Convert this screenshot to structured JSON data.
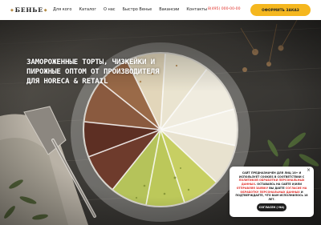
{
  "header": {
    "logo": "БЕНЬЕ",
    "nav": [
      "Для кого",
      "Каталог",
      "О нас",
      "Быстро Венье",
      "Вакансии",
      "Контакты"
    ],
    "phone": "8(495) 000-00-00",
    "order_button": "ОФОРМИТЬ ЗАКАЗ"
  },
  "hero": {
    "headline_lines": [
      "ЗАМОРОЖЕННЫЕ ТОРТЫ, ЧИЗКЕЙКИ И",
      "ПИРОЖНЫЕ ОПТОМ ОТ ПРОИЗВОДИТЕЛЯ",
      "ДЛЯ HORECA & RETAIL"
    ]
  },
  "cookie_popup": {
    "text_1": "САЙТ ПРЕДНАЗНАЧЕН ДЛЯ ЛИЦ 18+ И ИСПОЛЬЗУЕТ COOKIES В СООТВЕТСТВИИ С ",
    "link_1": "ПОЛИТИКОЙ ОБРАБОТКИ ПЕРСОНАЛЬНЫХ ДАННЫХ",
    "text_2": ". ОСТАВАЯСЬ НА САЙТЕ И/ИЛИ ",
    "link_2": "ОТПРАВЛЯЯ ЗАЯВКУ",
    "text_3": " ВЫ ДАЕТЕ ",
    "link_3": "СОГЛАСИЕ НА ОБРАБОТКУ ПЕРСОНАЛЬНЫХ ДАННЫХ",
    "text_4": " И ПОДТВЕРЖДАЕТЕ, ЧТО ВАМ ИСПОЛНИЛОСЬ 18 ЛЕТ.",
    "agree_button": "СОГЛАСЕН (-НА)",
    "close": "×"
  },
  "colors": {
    "accent_yellow": "#f5b71f",
    "phone_red": "#e0312b"
  }
}
